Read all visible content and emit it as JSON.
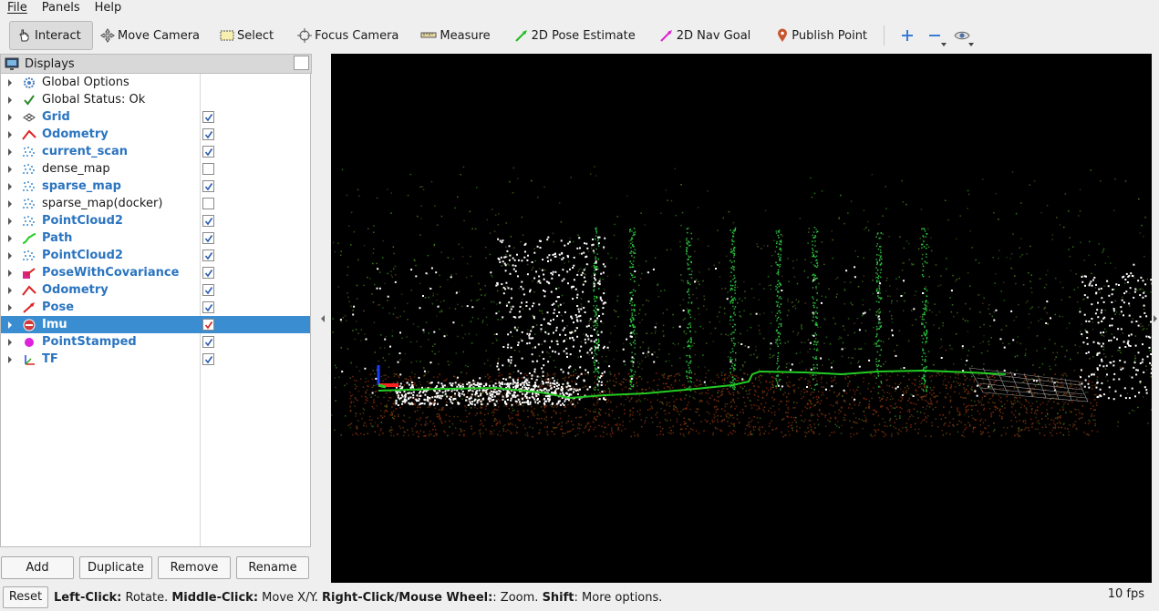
{
  "menu": [
    "File",
    "Panels",
    "Help"
  ],
  "toolbar": {
    "interact": "Interact",
    "move_camera": "Move Camera",
    "select": "Select",
    "focus_camera": "Focus Camera",
    "measure": "Measure",
    "pose_estimate": "2D Pose Estimate",
    "nav_goal": "2D Nav Goal",
    "publish_point": "Publish Point"
  },
  "displays": {
    "title": "Displays",
    "items": [
      {
        "label": "Global Options",
        "icon": "gear-icon",
        "bold": false,
        "checked": null
      },
      {
        "label": "Global Status: Ok",
        "icon": "check-icon",
        "bold": false,
        "checked": null
      },
      {
        "label": "Grid",
        "icon": "grid-icon",
        "bold": true,
        "checked": true
      },
      {
        "label": "Odometry",
        "icon": "odometry-icon",
        "bold": true,
        "checked": true
      },
      {
        "label": "current_scan",
        "icon": "pointcloud-icon",
        "bold": true,
        "checked": true
      },
      {
        "label": "dense_map",
        "icon": "pointcloud-icon",
        "bold": false,
        "checked": false
      },
      {
        "label": "sparse_map",
        "icon": "pointcloud-icon",
        "bold": true,
        "checked": true
      },
      {
        "label": "sparse_map(docker)",
        "icon": "pointcloud-icon",
        "bold": false,
        "checked": false
      },
      {
        "label": "PointCloud2",
        "icon": "pointcloud-icon",
        "bold": true,
        "checked": true
      },
      {
        "label": "Path",
        "icon": "path-icon",
        "bold": true,
        "checked": true
      },
      {
        "label": "PointCloud2",
        "icon": "pointcloud-icon",
        "bold": true,
        "checked": true
      },
      {
        "label": "PoseWithCovariance",
        "icon": "pose-covariance-icon",
        "bold": true,
        "checked": true
      },
      {
        "label": "Odometry",
        "icon": "odometry-icon",
        "bold": true,
        "checked": true
      },
      {
        "label": "Pose",
        "icon": "pose-icon",
        "bold": true,
        "checked": true
      },
      {
        "label": "Imu",
        "icon": "imu-icon",
        "bold": true,
        "checked": true,
        "selected": true
      },
      {
        "label": "PointStamped",
        "icon": "point-stamped-icon",
        "bold": true,
        "checked": true
      },
      {
        "label": "TF",
        "icon": "tf-icon",
        "bold": true,
        "checked": true
      }
    ]
  },
  "buttons": {
    "add": "Add",
    "duplicate": "Duplicate",
    "remove": "Remove",
    "rename": "Rename"
  },
  "status": {
    "reset": "Reset",
    "hint_1_key": "Left-Click:",
    "hint_1_val": " Rotate. ",
    "hint_2_key": "Middle-Click:",
    "hint_2_val": " Move X/Y. ",
    "hint_3_key": "Right-Click/Mouse Wheel:",
    "hint_3_val": ": Zoom. ",
    "hint_4_key": "Shift",
    "hint_4_val": ": More options.",
    "fps": "10 fps"
  },
  "colors": {
    "accent": "#3a8dd0",
    "bold_label": "#2a74c0",
    "path": "#22cc22"
  }
}
